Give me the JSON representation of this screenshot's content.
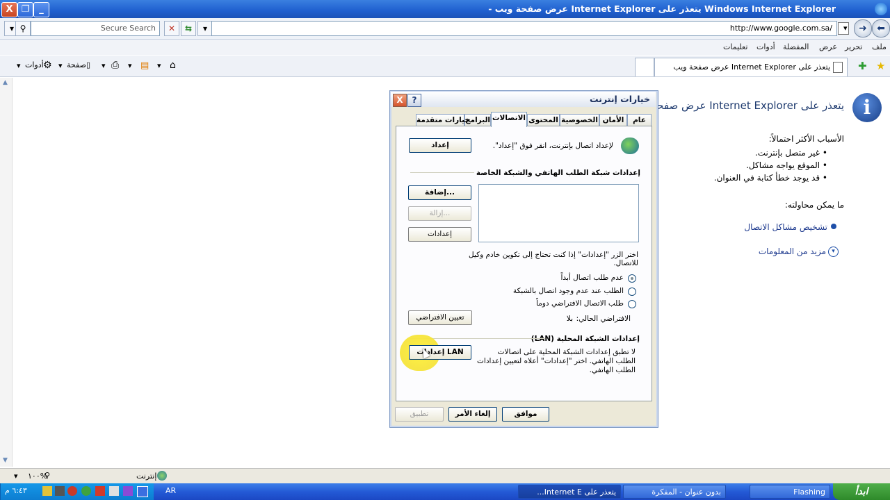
{
  "window": {
    "title": "Windows Internet Explorer يتعذر على Internet Explorer عرض صفحة ويب -",
    "ctrl_close": "X",
    "ctrl_restore": "❐",
    "ctrl_minimize": "_"
  },
  "address": {
    "url": "http://www.google.com.sa/",
    "search_placeholder": "Secure Search"
  },
  "menu": {
    "items": [
      "ملف",
      "تحرير",
      "عرض",
      "المفضلة",
      "أدوات",
      "تعليمات"
    ]
  },
  "command_bar": {
    "page_label": "صفحة",
    "tools_label": "أدوات",
    "tab_title": "يتعذر على Internet Explorer عرض صفحة ويب"
  },
  "page": {
    "heading": "يتعذر على Internet Explorer عرض صفحة",
    "causes_title": "الأسباب الأكثر احتمالاً:",
    "causes": [
      "غير متصل بإنترنت.",
      "الموقع يواجه مشاكل.",
      "قد يوجد خطأ كتابة في العنوان."
    ],
    "try_title": "ما يمكن محاولته:",
    "diagnose_link": "تشخيص مشاكل الاتصال",
    "more_info_link": "مزيد من المعلومات"
  },
  "dialog": {
    "title": "خيارات إنترنت",
    "help_btn": "?",
    "close_btn": "X",
    "tabs": [
      "عام",
      "الأمان",
      "الخصوصية",
      "المحتوى",
      "الاتصالات",
      "البرامج",
      "خيارات متقدمة"
    ],
    "selected_tab": "الاتصالات",
    "setup_text": "لإعداد اتصال بإنترنت، انقر فوق \"إعداد\".",
    "setup_button": "إعداد",
    "dialup_section": "إعدادات شبكة الطلب الهاتفي والشبكة الخاصة",
    "add_button": "إضافة...",
    "remove_button": "إزالة...",
    "settings_button": "إعدادات",
    "proxy_text_line1": "اختر الزر \"إعدادات\" إذا كنت تحتاج إلى تكوين خادم وكيل",
    "proxy_text_line2": "للاتصال.",
    "radio_never": "عدم طلب اتصال أبداً",
    "radio_when_none": "الطلب عند عدم وجود اتصال بالشبكة",
    "radio_always": "طلب الاتصال الافتراضي دوماً",
    "radio_selected": "never",
    "current_default": "الافتراضي الحالي:",
    "current_default_value": "بلا",
    "set_default_button": "تعيين الافتراضي",
    "lan_section": "إعدادات الشبكة المحلية (LAN)",
    "lan_text_line1": "لا تطبق إعدادات الشبكة المحلية على اتصالات",
    "lan_text_line2": "الطلب الهاتفي. اختر \"إعدادات\" أعلاه لتعيين إعدادات",
    "lan_text_line3": "الطلب الهاتفي.",
    "lan_button": "إعدادات LAN",
    "ok_button": "موافق",
    "cancel_button": "إلغاء الأمر",
    "apply_button": "تطبيق"
  },
  "status": {
    "zone": "إنترنت",
    "zoom": "١٠٠%"
  },
  "taskbar": {
    "start": "ابدأ",
    "lang": "AR",
    "time": "٦:٤٣ م",
    "task_ie": "يتعذر على Internet E...",
    "task_notepad": "بدون عنوان - المفكرة",
    "task_flashing": "Flashing"
  }
}
